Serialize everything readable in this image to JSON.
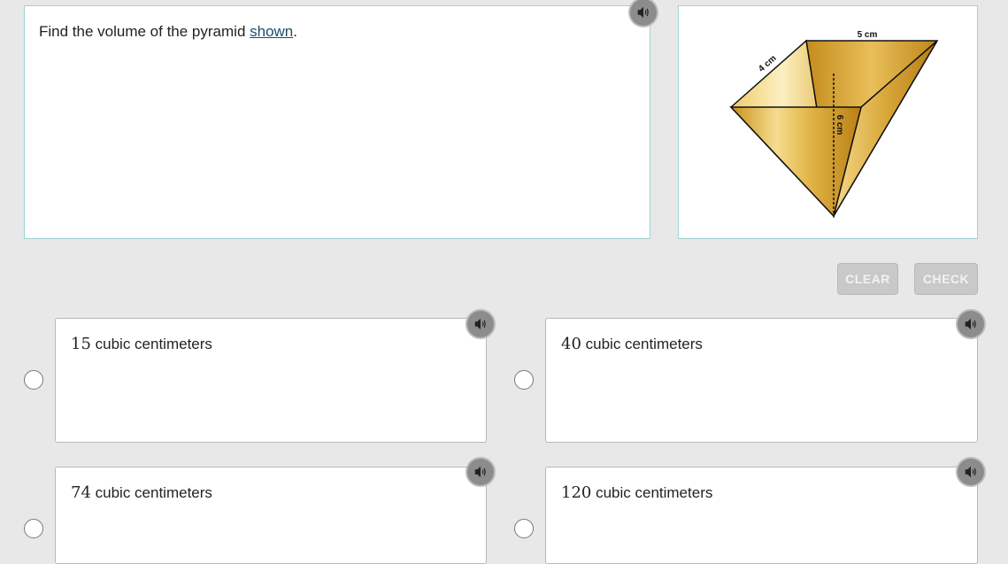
{
  "question": {
    "text_before": "Find the volume of the pyramid ",
    "link_text": "shown",
    "text_after": "."
  },
  "figure": {
    "top_label": "5 cm",
    "side_label": "4 cm",
    "height_label": "6 cm"
  },
  "buttons": {
    "clear": "CLEAR",
    "check": "CHECK"
  },
  "choices": [
    {
      "number": "15",
      "unit": " cubic centimeters"
    },
    {
      "number": "40",
      "unit": " cubic centimeters"
    },
    {
      "number": "74",
      "unit": " cubic centimeters"
    },
    {
      "number": "120",
      "unit": " cubic centimeters"
    }
  ],
  "icons": {
    "audio": "speaker-icon"
  },
  "colors": {
    "panel_border": "#9fd3d3",
    "link": "#1a4f6b",
    "pyramid_gold": "#d9a933"
  }
}
